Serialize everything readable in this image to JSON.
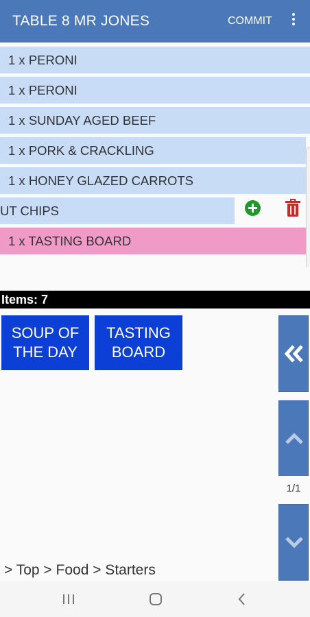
{
  "header": {
    "title": "TABLE 8 MR JONES",
    "commit_label": "COMMIT",
    "more_icon": "more-vert-icon"
  },
  "order_items": [
    "1 x PERONI",
    "1 x PERONI",
    "1 x SUNDAY AGED BEEF",
    "1 x PORK & CRACKLING",
    "1 x HONEY GLAZED CARROTS",
    "UT CHIPS",
    "1 x TASTING BOARD"
  ],
  "swipe_actions": {
    "add_icon": "add-circle-icon",
    "delete_icon": "trash-icon",
    "add_color": "#1e9a2a",
    "delete_color": "#e0201c"
  },
  "items_count": "Items: 7",
  "menu_buttons": [
    {
      "line1": "SOUP OF",
      "line2": "THE DAY"
    },
    {
      "line1": "TASTING",
      "line2": "BOARD"
    }
  ],
  "side_nav": {
    "back_icon": "double-chevron-left-icon",
    "up_icon": "chevron-up-icon",
    "down_icon": "chevron-down-icon",
    "page_indicator": "1/1"
  },
  "breadcrumb": "> Top > Food > Starters",
  "colors": {
    "accent": "#4a78b8",
    "row": "#c8dcf5",
    "highlight_row": "#f09ac8",
    "menu_button": "#0b3fd6"
  }
}
